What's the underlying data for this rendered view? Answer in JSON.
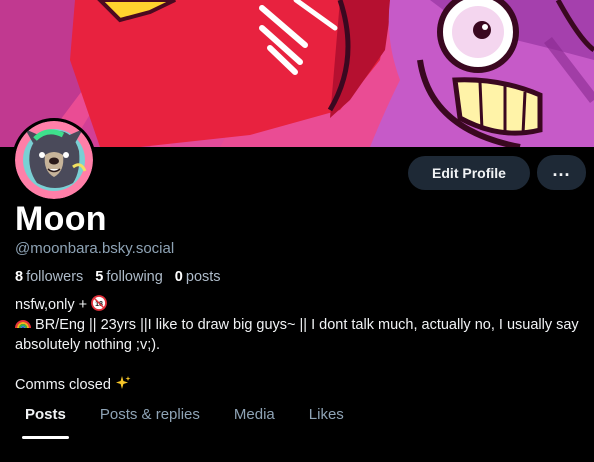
{
  "profile": {
    "display_name": "Moon",
    "handle": "@moonbara.bsky.social",
    "followers_count": "8",
    "followers_label": "followers",
    "following_count": "5",
    "following_label": "following",
    "posts_count": "0",
    "posts_label": "posts",
    "bio_line1": "nsfw,only + ",
    "bio_line2": " BR/Eng || 23yrs ||I like to draw big guys~ || I dont talk much, actually no, I usually say absolutely nothing ;v;).",
    "bio_line3": "Comms closed "
  },
  "actions": {
    "edit_label": "Edit Profile",
    "more_label": "..."
  },
  "tabs": [
    {
      "label": "Posts",
      "active": true
    },
    {
      "label": "Posts & replies",
      "active": false
    },
    {
      "label": "Media",
      "active": false
    },
    {
      "label": "Likes",
      "active": false
    }
  ],
  "icons": {
    "age_badge": "18-plus-icon",
    "rainbow": "rainbow-icon",
    "sparkles": "sparkles-icon"
  },
  "colors": {
    "background": "#000000",
    "button": "#1e2936",
    "muted_text": "#8ea3b5",
    "banner_pink": "#e0408a"
  }
}
